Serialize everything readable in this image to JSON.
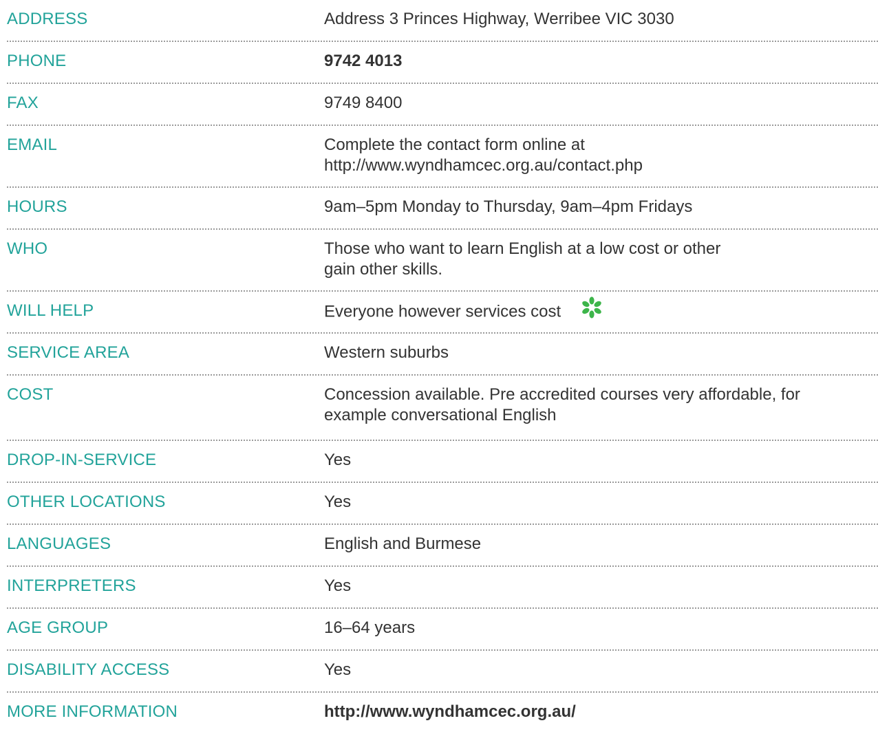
{
  "rows": [
    {
      "label": "ADDRESS",
      "value": [
        "Address 3 Princes Highway, Werribee VIC 3030"
      ]
    },
    {
      "label": "PHONE",
      "value": [
        "9742 4013"
      ]
    },
    {
      "label": "FAX",
      "value": [
        "9749 8400"
      ]
    },
    {
      "label": "EMAIL",
      "value": [
        "Complete the contact form online at",
        "http://www.wyndhamcec.org.au/contact.php"
      ]
    },
    {
      "label": "HOURS",
      "value": [
        "9am–5pm Monday to Thursday, 9am–4pm Fridays"
      ]
    },
    {
      "label": "WHO",
      "value": [
        "Those who want to learn English at a low cost or other",
        "gain other skills."
      ]
    },
    {
      "label": "WILL HELP",
      "value": [
        "Everyone however services cost"
      ],
      "icon": "asterisk-flower-icon",
      "icon_color": "#3db54a"
    },
    {
      "label": "SERVICE AREA",
      "value": [
        "Western suburbs"
      ]
    },
    {
      "label": "COST",
      "value": [
        "Concession available. Pre accredited courses very affordable, for",
        "example conversational English"
      ]
    },
    {
      "label": "DROP-IN-SERVICE",
      "value": [
        "Yes"
      ]
    },
    {
      "label": "OTHER LOCATIONS",
      "value": [
        "Yes"
      ]
    },
    {
      "label": "LANGUAGES",
      "value": [
        "English and Burmese"
      ]
    },
    {
      "label": "INTERPRETERS",
      "value": [
        "Yes"
      ]
    },
    {
      "label": "AGE GROUP",
      "value": [
        "16–64 years"
      ]
    },
    {
      "label": "DISABILITY ACCESS",
      "value": [
        "Yes"
      ]
    },
    {
      "label": "MORE INFORMATION",
      "value": [
        "http://www.wyndhamcec.org.au/"
      ]
    }
  ],
  "colors": {
    "label": "#22a39a",
    "value": "#333333",
    "divider": "#9a9a9a"
  }
}
